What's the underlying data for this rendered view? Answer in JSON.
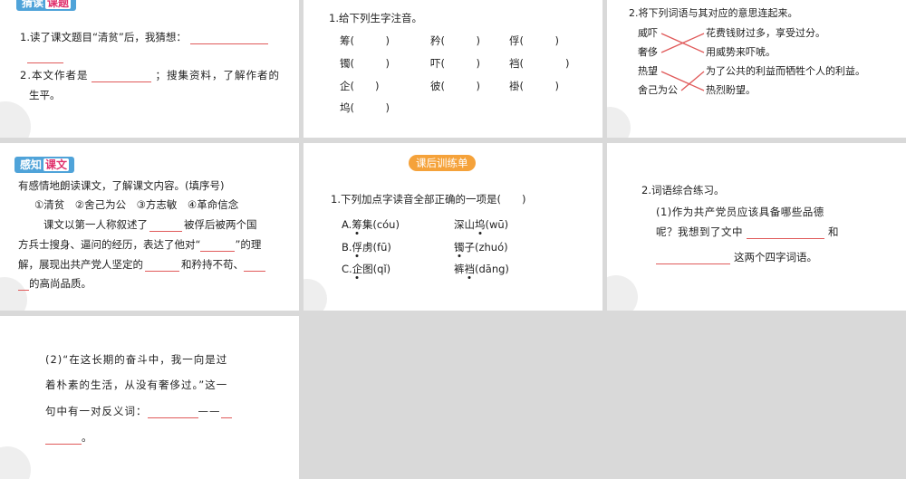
{
  "p1": {
    "tag_a": "猜读",
    "tag_b": "课题",
    "q1": "1.读了课文题目“清贫”后，我猜想：",
    "q2a": "2.本文作者是",
    "q2b": "；搜集资料，了解作者的",
    "q2c": "生平。"
  },
  "p2": {
    "title": "1.给下列生字注音。",
    "rows": [
      [
        "筹(　　　)",
        "矜(　　　)",
        "俘(　　　)"
      ],
      [
        "镯(　　　)",
        "吓(　　　)",
        "裆(　　　　)"
      ],
      [
        "企(　　)",
        "彼(　　　)",
        "褂(　　　)"
      ],
      [
        "坞(　　　)"
      ]
    ]
  },
  "p3": {
    "title": "2.将下列词语与其对应的意思连起来。",
    "left": [
      "威吓",
      "奢侈",
      "热望",
      "舍己为公"
    ],
    "right": [
      "花费钱财过多，享受过分。",
      "用威势来吓唬。",
      "为了公共的利益而牺牲个人的利益。",
      "热烈盼望。"
    ]
  },
  "p4": {
    "tag_a": "感知",
    "tag_b": "课文",
    "l1": "有感情地朗读课文，了解课文内容。(填序号)",
    "l2": "①清贫　②舍己为公　③方志敏　④革命信念",
    "l3a": "课文以第一人称叙述了",
    "l3b": "被俘后被两个国",
    "l4a": "方兵士搜身、逼问的经历，表达了他对“",
    "l4b": "”的理",
    "l5a": "解，展现出共产党人坚定的",
    "l5b": "和矜持不苟、",
    "l6": "的高尚品质。"
  },
  "p5": {
    "tag": "课后训练单",
    "q": "1.下列加点字读音全部正确的一项是(　　)",
    "opts": [
      {
        "letter": "A.",
        "w1a": "筹",
        "w1b": "集(cóu)",
        "w2a": "深山",
        "w2b": "坞",
        "w2c": "(wū)"
      },
      {
        "letter": "B.",
        "w1a": "俘",
        "w1b": "虏(fū)",
        "w2a": "镯",
        "w2b": "子(zhuó)",
        "w2c": ""
      },
      {
        "letter": "C.",
        "w1a": "企",
        "w1b": "图(qǐ)",
        "w2a": "裤",
        "w2b": "裆",
        "w2c": "(dāng)"
      }
    ]
  },
  "p6": {
    "title": "2.词语综合练习。",
    "l1": "(1)作为共产党员应该具备哪些品德",
    "l2a": "呢？我想到了文中",
    "l2b": "和",
    "l3": "这两个四字词语。"
  },
  "p7": {
    "l1": "(2)“在这长期的奋斗中，我一向是过",
    "l2": "着朴素的生活，从没有奢侈过。”这一",
    "l3a": "句中有一对反义词：",
    "l3b": "——",
    "l4": "。"
  },
  "colors": {
    "tag_bg": "#4fa3d9",
    "orange": "#f5a23a",
    "blank": "#e05a5a"
  }
}
